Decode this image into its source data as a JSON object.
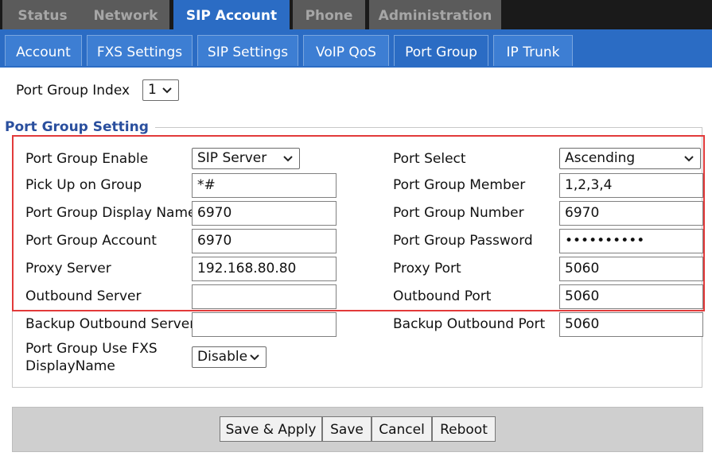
{
  "top_tabs": [
    "Status",
    "Network",
    "SIP Account",
    "Phone",
    "Administration"
  ],
  "sub_tabs": [
    "Account",
    "FXS Settings",
    "SIP Settings",
    "VoIP QoS",
    "Port Group",
    "IP Trunk"
  ],
  "index": {
    "label": "Port Group Index",
    "value": "1"
  },
  "section_title": "Port Group Setting",
  "left_fields": {
    "enable": {
      "label": "Port Group Enable",
      "value": "SIP Server"
    },
    "pickup": {
      "label": "Pick Up on Group",
      "value": "*#"
    },
    "display_name": {
      "label": "Port Group Display Name",
      "value": "6970"
    },
    "account": {
      "label": "Port Group Account",
      "value": "6970"
    },
    "proxy_server": {
      "label": "Proxy Server",
      "value": "192.168.80.80"
    },
    "outbound_server": {
      "label": "Outbound Server",
      "value": ""
    },
    "backup_outbound_server": {
      "label": "Backup Outbound Server",
      "value": ""
    },
    "use_fxs_line1": "Port Group Use FXS",
    "use_fxs_line2": "DisplayName",
    "use_fxs_value": "Disable"
  },
  "right_fields": {
    "port_select": {
      "label": "Port Select",
      "value": "Ascending"
    },
    "member": {
      "label": "Port Group Member",
      "value": "1,2,3,4"
    },
    "number": {
      "label": "Port Group Number",
      "value": "6970"
    },
    "password": {
      "label": "Port Group Password",
      "value": "••••••••••"
    },
    "proxy_port": {
      "label": "Proxy Port",
      "value": "5060"
    },
    "outbound_port": {
      "label": "Outbound Port",
      "value": "5060"
    },
    "backup_outbound_port": {
      "label": "Backup Outbound Port",
      "value": "5060"
    }
  },
  "buttons": {
    "save_apply": "Save & Apply",
    "save": "Save",
    "cancel": "Cancel",
    "reboot": "Reboot"
  },
  "colors": {
    "tab_active": "#2b6cc4",
    "tab_inactive": "#5b5b5b",
    "highlight": "#e23a3a",
    "section_title": "#2a4f9e"
  }
}
